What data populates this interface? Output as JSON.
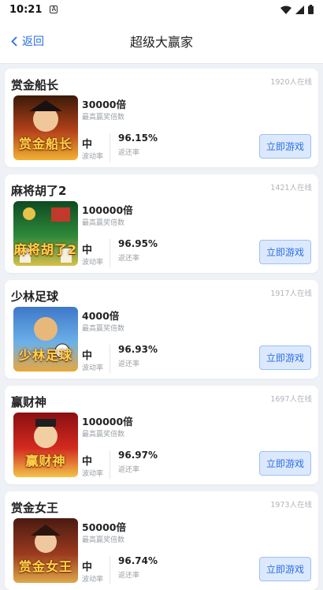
{
  "status_bar": {
    "time": "10:21"
  },
  "header": {
    "back_label": "返回",
    "title": "超级大赢家"
  },
  "labels": {
    "multiplier_caption": "最高赢奖倍数",
    "volatility_caption": "波动率",
    "rtp_caption": "返还率",
    "play_button": "立即游戏"
  },
  "games": [
    {
      "name": "赏金船长",
      "online": "1920人在线",
      "multiplier": "30000倍",
      "volatility": "中",
      "rtp": "96.15%",
      "thumb_text": "赏金船长",
      "thumb_colors": [
        "#3a1a08",
        "#b5421a",
        "#f2b233"
      ]
    },
    {
      "name": "麻将胡了2",
      "online": "1421人在线",
      "multiplier": "100000倍",
      "volatility": "中",
      "rtp": "96.95%",
      "thumb_text": "麻将胡了2",
      "thumb_colors": [
        "#0e4a22",
        "#2f8a3a",
        "#d8c04a"
      ]
    },
    {
      "name": "少林足球",
      "online": "1917人在线",
      "multiplier": "4000倍",
      "volatility": "中",
      "rtp": "96.93%",
      "thumb_text": "少林足球",
      "thumb_colors": [
        "#3e78c9",
        "#6bb0e8",
        "#e9a83a"
      ]
    },
    {
      "name": "赢财神",
      "online": "1697人在线",
      "multiplier": "100000倍",
      "volatility": "中",
      "rtp": "96.97%",
      "thumb_text": "赢财神",
      "thumb_colors": [
        "#8a0f12",
        "#d22a1e",
        "#f4c34a"
      ]
    },
    {
      "name": "赏金女王",
      "online": "1973人在线",
      "multiplier": "50000倍",
      "volatility": "中",
      "rtp": "96.74%",
      "thumb_text": "赏金女王",
      "thumb_colors": [
        "#4a1a12",
        "#9a3a1e",
        "#e0a84a"
      ]
    }
  ]
}
